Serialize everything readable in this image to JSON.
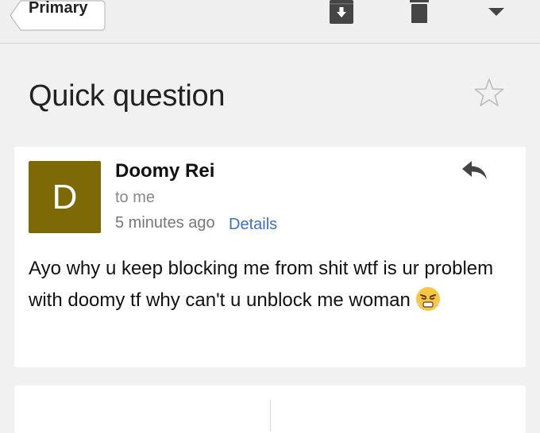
{
  "toolbar": {
    "back_label": "Primary",
    "icons": [
      "archive-icon",
      "trash-icon",
      "more-menu-icon"
    ]
  },
  "message": {
    "subject": "Quick question",
    "sender_name": "Doomy Rei",
    "avatar_letter": "D",
    "avatar_color": "#7d6a06",
    "recipient": "to me",
    "time": "5 minutes ago",
    "details_label": "Details",
    "body": "Ayo why u keep blocking me from shit wtf is ur problem with doomy tf why can't u unblock me woman",
    "body_emoji": "angry-face-emoji"
  },
  "colors": {
    "background": "#f1f1f1",
    "card": "#ffffff",
    "link": "#3d6fc2",
    "icon": "#444444"
  }
}
